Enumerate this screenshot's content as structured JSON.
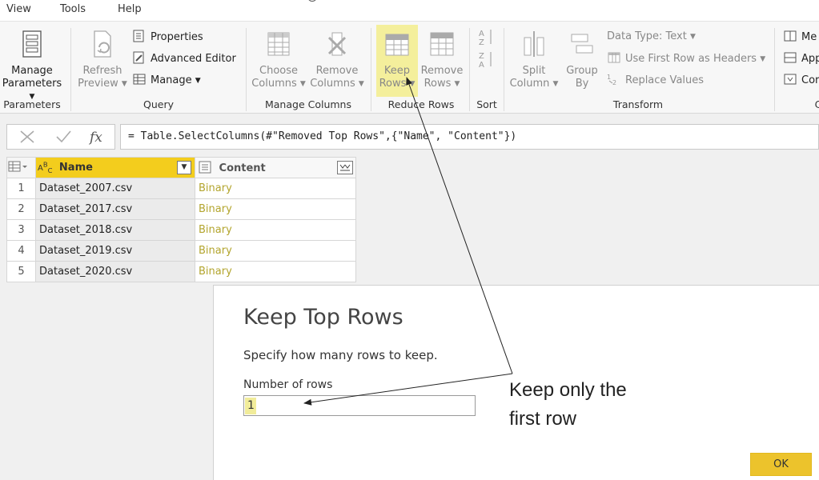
{
  "menu": {
    "view": "View",
    "tools": "Tools",
    "help": "Help"
  },
  "ribbon": {
    "parameters": {
      "manage_parameters": "Manage",
      "manage_parameters2": "Parameters",
      "group_label": "Parameters"
    },
    "query": {
      "refresh_preview": "Refresh",
      "refresh_preview2": "Preview",
      "properties": "Properties",
      "advanced_editor": "Advanced Editor",
      "manage": "Manage",
      "group_label": "Query"
    },
    "manage_columns": {
      "choose_columns": "Choose",
      "choose_columns2": "Columns",
      "remove_columns": "Remove",
      "remove_columns2": "Columns",
      "group_label": "Manage Columns"
    },
    "reduce_rows": {
      "keep_rows": "Keep",
      "keep_rows2": "Rows",
      "remove_rows": "Remove",
      "remove_rows2": "Rows",
      "group_label": "Reduce Rows"
    },
    "sort": {
      "group_label": "Sort"
    },
    "transform": {
      "split_column": "Split",
      "split_column2": "Column",
      "group_by": "Group",
      "group_by2": "By",
      "data_type": "Data Type: Text",
      "use_first_row": "Use First Row as Headers",
      "replace_values": "Replace Values",
      "group_label": "Transform"
    },
    "combine": {
      "merge": "Me",
      "append": "App",
      "combine": "Cor",
      "group_label": "C"
    }
  },
  "formula": {
    "text": "= Table.SelectColumns(#\"Removed Top Rows\",{\"Name\", \"Content\"})"
  },
  "table": {
    "columns": [
      "Name",
      "Content"
    ],
    "rows": [
      {
        "num": "1",
        "name": "Dataset_2007.csv",
        "content": "Binary"
      },
      {
        "num": "2",
        "name": "Dataset_2017.csv",
        "content": "Binary"
      },
      {
        "num": "3",
        "name": "Dataset_2018.csv",
        "content": "Binary"
      },
      {
        "num": "4",
        "name": "Dataset_2019.csv",
        "content": "Binary"
      },
      {
        "num": "5",
        "name": "Dataset_2020.csv",
        "content": "Binary"
      }
    ]
  },
  "dialog": {
    "title": "Keep Top Rows",
    "description": "Specify how many rows to keep.",
    "field_label": "Number of rows",
    "field_value": "1",
    "ok_label": "OK"
  },
  "annotation": {
    "line1": "Keep only the",
    "line2": "first row"
  },
  "colors": {
    "accent_yellow": "#f4ef9c",
    "ok_button": "#ecc32c",
    "binary_text": "#b3a52e"
  }
}
